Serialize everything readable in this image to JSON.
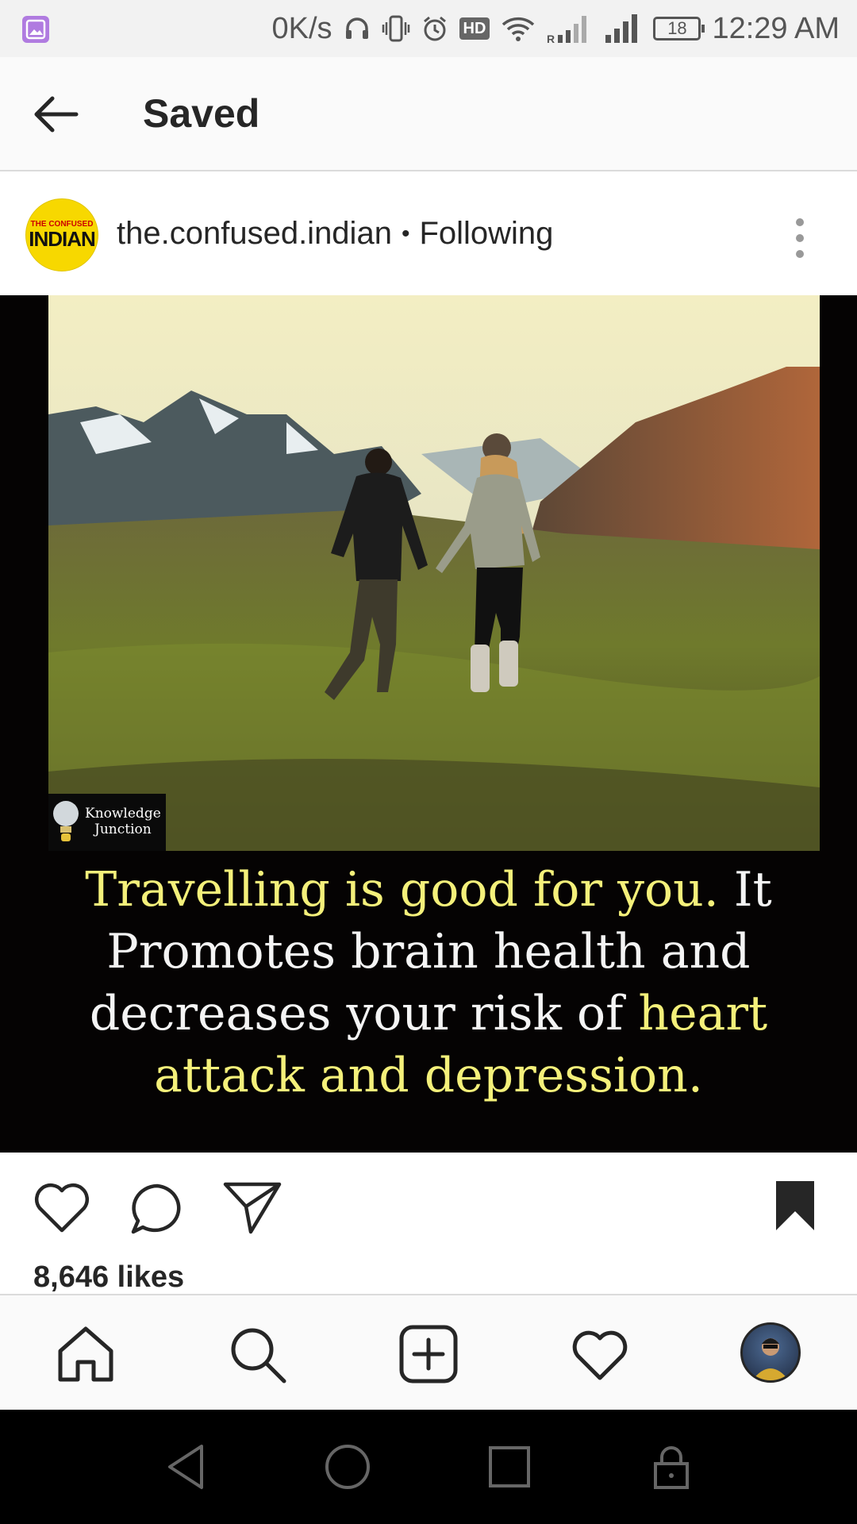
{
  "status_bar": {
    "speed": "0K/s",
    "hd": "HD",
    "battery": "18",
    "time": "12:29 AM"
  },
  "header": {
    "title": "Saved"
  },
  "post": {
    "avatar_text_top": "THE CONFUSED",
    "avatar_text_main": "INDIAN",
    "username": "the.confused.indian",
    "separator": "•",
    "following": "Following",
    "image": {
      "badge_line1": "Knowledge",
      "badge_line2": "Junction",
      "quote": {
        "p1": "Travelling is good for you.",
        "p2": " It Promotes brain health and decreases your risk of ",
        "p3": "heart attack and depression."
      }
    },
    "likes": "8,646 likes"
  },
  "colors": {
    "highlight": "#f4f07a",
    "avatar_bg": "#f7d800"
  },
  "icons": {
    "like": "heart-icon",
    "comment": "comment-icon",
    "share": "paper-plane-icon",
    "save": "bookmark-icon"
  }
}
